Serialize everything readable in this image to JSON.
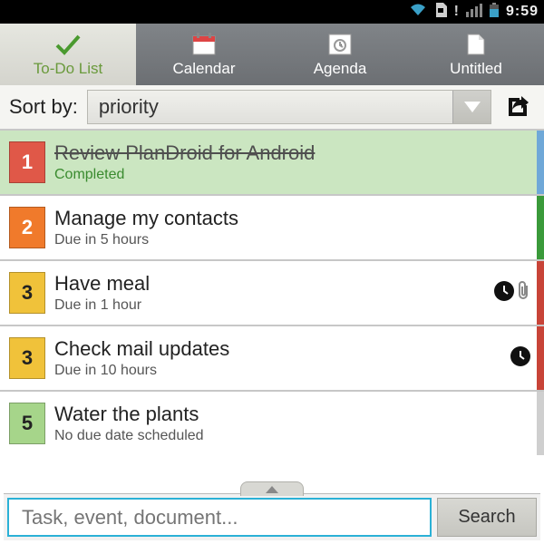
{
  "statusbar": {
    "time": "9:59"
  },
  "tabs": {
    "todo": "To-Do List",
    "calendar": "Calendar",
    "agenda": "Agenda",
    "untitled": "Untitled"
  },
  "sort": {
    "label": "Sort by:",
    "value": "priority"
  },
  "tasks": [
    {
      "priority": "1",
      "title": "Review PlanDroid for Android",
      "sub": "Completed"
    },
    {
      "priority": "2",
      "title": "Manage my contacts",
      "sub": "Due in 5 hours"
    },
    {
      "priority": "3",
      "title": "Have meal",
      "sub": "Due in 1 hour"
    },
    {
      "priority": "3",
      "title": "Check mail updates",
      "sub": "Due in 10 hours"
    },
    {
      "priority": "5",
      "title": "Water the plants",
      "sub": "No due date scheduled"
    }
  ],
  "search": {
    "placeholder": "Task, event, document...",
    "button": "Search"
  }
}
